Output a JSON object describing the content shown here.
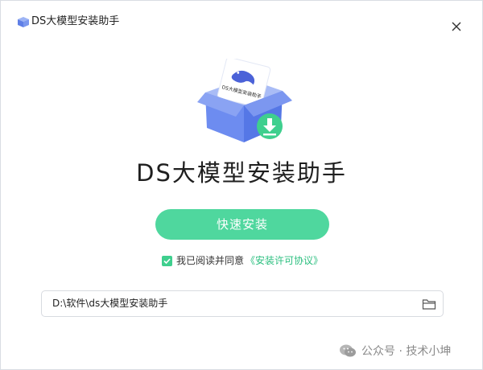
{
  "window": {
    "title": "DS大模型安装助手",
    "app_icon": "package-box-icon",
    "close_icon": "close-icon"
  },
  "illustration": {
    "icon": "box-with-download-illustration",
    "card_text": "DS大模型安装助手",
    "accent_color": "#4fd79e",
    "box_color": "#6d8cf0"
  },
  "product_name": "DS大模型安装助手",
  "install_button": {
    "label": "快速安装",
    "color": "#4fd79e"
  },
  "agreement": {
    "checked": true,
    "text": "我已阅读并同意",
    "link_text": "《安装许可协议》",
    "link_color": "#2bbf7f"
  },
  "install_path": {
    "value": "D:\\软件\\ds大模型安装助手",
    "folder_icon": "folder-icon"
  },
  "watermark": {
    "icon": "wechat-icon",
    "text": "公众号 · 技术小坤"
  }
}
